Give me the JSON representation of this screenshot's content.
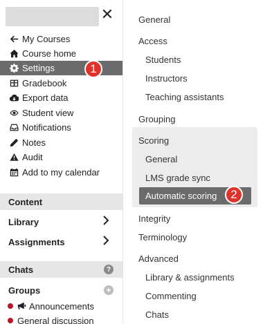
{
  "sidebar": {
    "close_glyph": "✕",
    "nav": [
      {
        "label": "My Courses",
        "icon": "arrow-left-icon"
      },
      {
        "label": "Course home",
        "icon": "home-icon"
      },
      {
        "label": "Settings",
        "icon": "gear-icon",
        "active": true
      },
      {
        "label": "Gradebook",
        "icon": "table-icon"
      },
      {
        "label": "Export data",
        "icon": "cloud-download-icon"
      },
      {
        "label": "Student view",
        "icon": "eye-icon"
      },
      {
        "label": "Notifications",
        "icon": "inbox-icon"
      },
      {
        "label": "Notes",
        "icon": "pencil-icon"
      },
      {
        "label": "Audit",
        "icon": "warning-icon"
      },
      {
        "label": "Add to my calendar",
        "icon": "calendar-icon"
      }
    ],
    "content_header": "Content",
    "library_label": "Library",
    "assignments_label": "Assignments",
    "chats_header": "Chats",
    "chats_help": "?",
    "groups_label": "Groups",
    "groups_add": "+",
    "channels": [
      {
        "label": "Announcements",
        "icon": "megaphone-icon"
      },
      {
        "label": "General discussion"
      }
    ]
  },
  "markers": {
    "one": "1",
    "two": "2",
    "color": "#e0322b"
  },
  "settings": {
    "general": "General",
    "access": "Access",
    "students": "Students",
    "instructors": "Instructors",
    "teaching_assistants": "Teaching assistants",
    "grouping": "Grouping",
    "scoring": "Scoring",
    "scoring_general": "General",
    "lms_grade_sync": "LMS grade sync",
    "automatic_scoring": "Automatic scoring",
    "integrity": "Integrity",
    "terminology": "Terminology",
    "advanced": "Advanced",
    "library_assignments": "Library & assignments",
    "commenting": "Commenting",
    "chats": "Chats"
  }
}
